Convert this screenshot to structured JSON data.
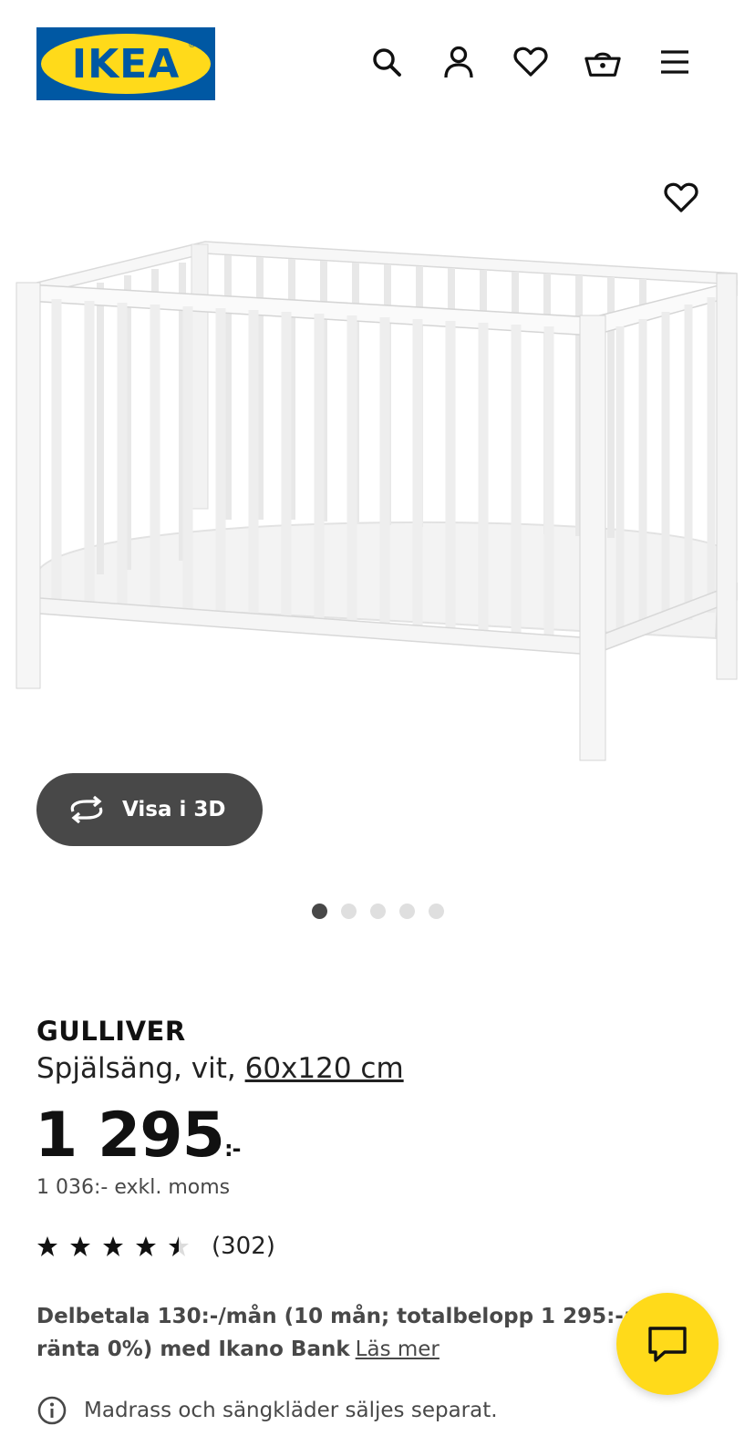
{
  "header": {
    "logo_text": "IKEA",
    "icons": [
      "search-icon",
      "account-icon",
      "heart-icon",
      "basket-icon",
      "menu-icon"
    ]
  },
  "gallery": {
    "view3d_label": "Visa i 3D",
    "dot_count": 5,
    "active_dot": 0
  },
  "product": {
    "name": "GULLIVER",
    "desc_prefix": "Spjälsäng, vit, ",
    "size_link": "60x120 cm",
    "price_main": "1 295",
    "price_suffix": ":-",
    "price_ex_vat": "1 036:- exkl. moms",
    "rating_value": 4.5,
    "rating_count": "(302)"
  },
  "installment": {
    "text": "Delbetala 130:-/mån (10 mån; totalbelopp 1 295:-; eff. ränta 0%) med Ikano Bank",
    "read_more": "Läs mer"
  },
  "note": {
    "text": "Madrass och sängkläder säljes separat."
  },
  "colors": {
    "ikea_blue": "#0058a3",
    "ikea_yellow": "#ffda1a",
    "dark_gray": "#484848"
  }
}
